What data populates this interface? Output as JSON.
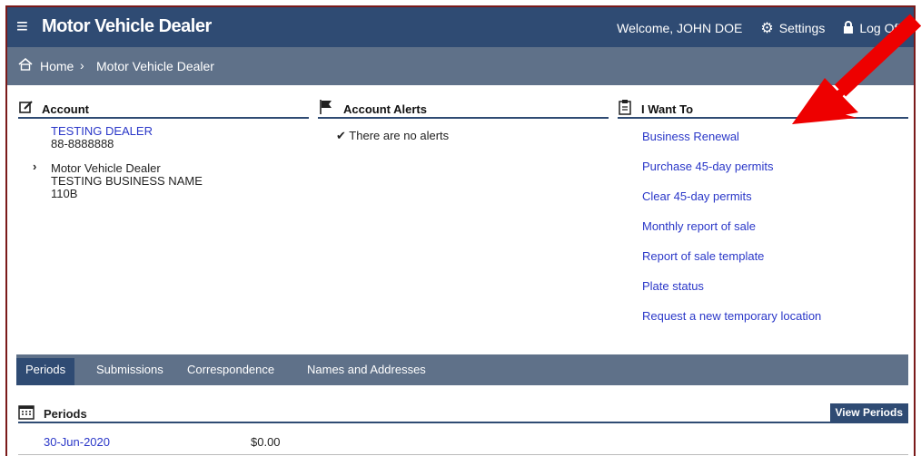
{
  "header": {
    "app_title": "Motor Vehicle Dealer",
    "welcome": "Welcome, JOHN DOE",
    "settings_label": "Settings",
    "logoff_label": "Log Off",
    "menu_icon": "hamburger-icon",
    "settings_icon": "gear-icon",
    "logoff_icon": "lock-icon"
  },
  "breadcrumb": {
    "home": "Home",
    "separator": "›",
    "current": "Motor Vehicle Dealer"
  },
  "account": {
    "title": "Account",
    "name": "TESTING DEALER",
    "number": "88-8888888",
    "type": "Motor Vehicle Dealer",
    "business_name": "TESTING BUSINESS NAME",
    "code": "110B"
  },
  "alerts": {
    "title": "Account Alerts",
    "message": "There are no alerts"
  },
  "i_want_to": {
    "title": "I Want To",
    "links": [
      "Business Renewal",
      "Purchase 45-day permits",
      "Clear 45-day permits",
      "Monthly report of sale",
      "Report of sale template",
      "Plate status",
      "Request a new temporary location"
    ]
  },
  "tabs": [
    "Periods",
    "Submissions",
    "Correspondence",
    "Names and Addresses"
  ],
  "periods": {
    "title": "Periods",
    "view_button": "View Periods",
    "rows": [
      {
        "date": "30-Jun-2020",
        "amount": "$0.00"
      }
    ]
  },
  "colors": {
    "header_bg": "#2f4b73",
    "breadcrumb_bg": "#5f7189",
    "link": "#2a37c8",
    "annotation_arrow": "#ee0000",
    "frame_border": "#7a1a1a"
  }
}
